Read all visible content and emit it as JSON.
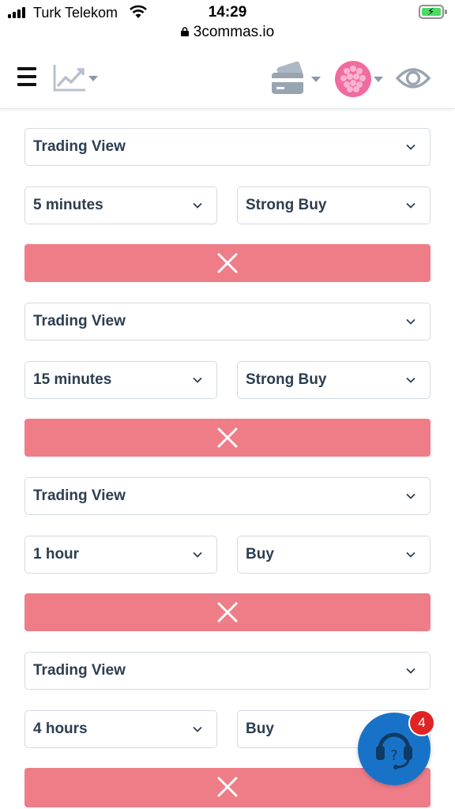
{
  "status_bar": {
    "carrier": "Turk Telekom",
    "time": "14:29"
  },
  "browser": {
    "url": "3commas.io"
  },
  "header": {
    "icons": [
      "menu-icon",
      "chart-icon",
      "wallet-icon",
      "avatar",
      "eye-icon"
    ]
  },
  "conditions": [
    {
      "source": "Trading View",
      "timeframe": "5 minutes",
      "signal": "Strong Buy"
    },
    {
      "source": "Trading View",
      "timeframe": "15 minutes",
      "signal": "Strong Buy"
    },
    {
      "source": "Trading View",
      "timeframe": "1 hour",
      "signal": "Buy"
    },
    {
      "source": "Trading View",
      "timeframe": "4 hours",
      "signal": "Buy"
    }
  ],
  "support_widget": {
    "badge_count": "4"
  },
  "colors": {
    "remove_button": "#ee7d88",
    "support_widget": "#1873c8",
    "badge": "#e02424",
    "field_border": "#d3dbe2",
    "text": "#2c3e50"
  }
}
